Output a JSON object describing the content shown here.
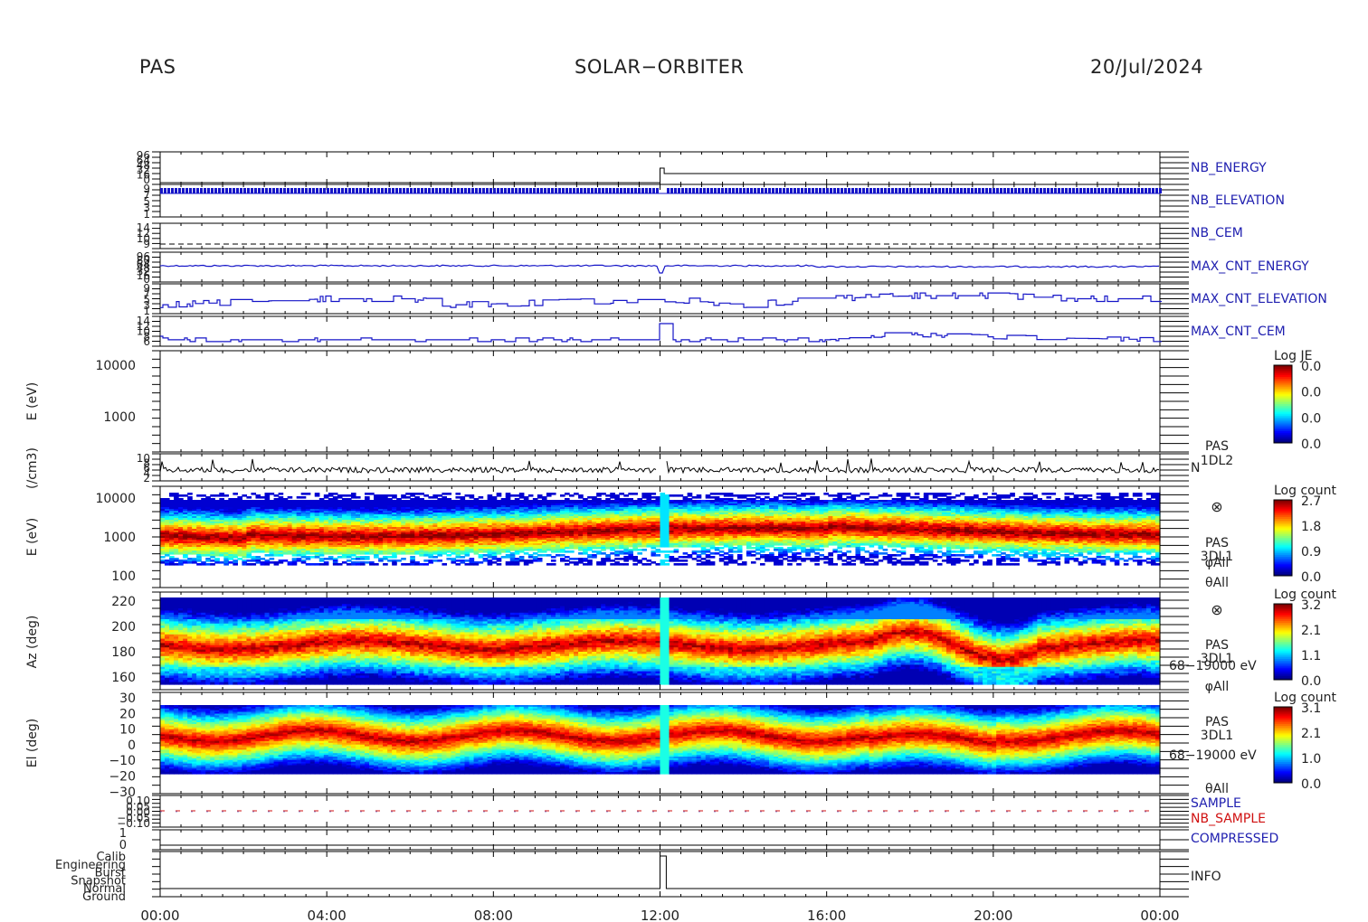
{
  "header": {
    "instrument": "PAS",
    "mission": "SOLAR−ORBITER",
    "date": "20/Jul/2024"
  },
  "colors": {
    "blue_trace": "#1515c8",
    "label_blue": "#2020b0",
    "label_red": "#d01010",
    "axis": "#000000"
  },
  "chart_data": [
    {
      "type": "line",
      "name": "NB_ENERGY",
      "label": "NB_ENERGY",
      "label_color": "blue",
      "ytick_labels": [
        "96",
        "64",
        "48",
        "32",
        "16",
        "0"
      ],
      "x": [
        "00:00",
        "12:00",
        "12:04",
        "24:00"
      ],
      "values": [
        5,
        5,
        32,
        32
      ],
      "grid": false
    },
    {
      "type": "line",
      "name": "NB_ELEVATION",
      "label": "NB_ELEVATION",
      "label_color": "blue",
      "ytick_labels": [
        "9",
        "7",
        "5",
        "3",
        "1"
      ],
      "description_values": "dense oscillation between 6 and 7, brief drop at 12:05",
      "grid": false
    },
    {
      "type": "line",
      "name": "NB_CEM",
      "label": "NB_CEM",
      "label_color": "blue",
      "ytick_labels": [
        "14",
        "12",
        "10",
        "9"
      ],
      "x": [
        "00:00",
        "24:00"
      ],
      "values": [
        9,
        9
      ],
      "style": "dashed"
    },
    {
      "type": "line",
      "name": "MAX_CNT_ENERGY",
      "label": "MAX_CNT_ENERGY",
      "label_color": "blue",
      "ytick_labels": [
        "96",
        "80",
        "64",
        "48",
        "32",
        "16",
        "0"
      ],
      "x": [
        "00:00",
        "12:00",
        "24:00"
      ],
      "values": [
        48,
        48,
        46
      ]
    },
    {
      "type": "line",
      "name": "MAX_CNT_ELEVATION",
      "label": "MAX_CNT_ELEVATION",
      "label_color": "blue",
      "ytick_labels": [
        "9",
        "7",
        "5",
        "3",
        "1"
      ],
      "x": [
        "00:00",
        "02:00",
        "04:00",
        "06:00",
        "07:00",
        "10:00",
        "12:00",
        "14:00",
        "16:00",
        "18:00",
        "20:00",
        "22:00",
        "24:00"
      ],
      "values": [
        3,
        4,
        5,
        5,
        3,
        4,
        5,
        3,
        5,
        6,
        6,
        5,
        5
      ]
    },
    {
      "type": "line",
      "name": "MAX_CNT_CEM",
      "label": "MAX_CNT_CEM",
      "label_color": "blue",
      "ytick_labels": [
        "14",
        "12",
        "10",
        "8",
        "6"
      ],
      "x": [
        "00:00",
        "06:00",
        "12:00",
        "16:00",
        "17:30",
        "20:00",
        "24:00"
      ],
      "values": [
        7,
        7,
        7,
        7,
        9,
        8,
        7
      ]
    },
    {
      "type": "heatmap",
      "name": "1DL2 E",
      "ylabel": "E (eV)",
      "yscale": "log",
      "ylim": [
        100,
        20000
      ],
      "ytick_labels": [
        "10000",
        "1000"
      ],
      "colorbar": {
        "title": "Log JE",
        "ticks": [
          "0.0",
          "0.0",
          "0.0",
          "0.0"
        ]
      },
      "content": "empty"
    },
    {
      "type": "line",
      "name": "N",
      "ylabel": "(/cm3)",
      "ytick_labels": [
        "10",
        "8",
        "6",
        "4",
        "2"
      ],
      "side_labels": [
        "PAS",
        "1DL2",
        "N"
      ],
      "description_values": "noisy trace around 5 with occasional spikes to 9, gap at 12:00"
    },
    {
      "type": "heatmap",
      "name": "3DL1 E",
      "ylabel": "E (eV)",
      "yscale": "log",
      "ylim": [
        100,
        20000
      ],
      "ytick_labels": [
        "10000",
        "1000",
        "100"
      ],
      "colorbar": {
        "title": "Log count",
        "ticks": [
          "2.7",
          "1.8",
          "0.9",
          "0.0"
        ]
      },
      "side_labels": [
        "⊗",
        "PAS",
        "3DL1",
        "φAll",
        "θAll"
      ],
      "peak_energy_eV": 1200
    },
    {
      "type": "heatmap",
      "name": "Az",
      "ylabel": "Az (deg)",
      "ylim": [
        152,
        224
      ],
      "ytick_labels": [
        "220",
        "200",
        "180",
        "160"
      ],
      "colorbar": {
        "title": "Log count",
        "ticks": [
          "3.2",
          "2.1",
          "1.1",
          "0.0"
        ]
      },
      "side_labels": [
        "⊗",
        "PAS",
        "3DL1",
        "68−19000 eV",
        "φAll"
      ],
      "peak_az_deg": 182
    },
    {
      "type": "heatmap",
      "name": "El",
      "ylabel": "El (deg)",
      "ylim": [
        -30,
        30
      ],
      "ytick_labels": [
        "30",
        "20",
        "10",
        "0",
        "−10",
        "−20",
        "−30"
      ],
      "colorbar": {
        "title": "Log count",
        "ticks": [
          "3.1",
          "2.1",
          "1.0",
          "0.0"
        ]
      },
      "side_labels": [
        "PAS",
        "3DL1",
        "68−19000 eV",
        "θAll"
      ],
      "peak_el_deg": 2
    },
    {
      "type": "line",
      "name": "SAMPLE",
      "labels": [
        "SAMPLE",
        "NB_SAMPLE"
      ],
      "ytick_labels": [
        "0.10",
        "0.05",
        "0.00",
        "−0.05",
        "−0.10"
      ],
      "x": [
        "00:00",
        "24:00"
      ],
      "values": [
        0,
        0
      ],
      "style": "dashed"
    },
    {
      "type": "line",
      "name": "COMPRESSED",
      "label": "COMPRESSED",
      "ytick_labels": [
        "1",
        "0"
      ],
      "x": [
        "00:00",
        "24:00"
      ],
      "values": [
        0,
        0
      ]
    },
    {
      "type": "line",
      "name": "INFO",
      "label": "INFO",
      "ytick_labels": [
        "Calib",
        "Engineering",
        "Burst",
        "Snapshot",
        "Normal",
        "Ground"
      ],
      "x": [
        "00:00",
        "12:00",
        "12:00",
        "12:10",
        "12:10",
        "24:00"
      ],
      "values": [
        "Ground",
        "Ground",
        "Calib",
        "Calib",
        "Ground",
        "Ground"
      ]
    }
  ],
  "x_axis": {
    "ticks": [
      "00:00",
      "04:00",
      "08:00",
      "12:00",
      "16:00",
      "20:00",
      "00:00"
    ],
    "range_hours": [
      0,
      24
    ]
  }
}
